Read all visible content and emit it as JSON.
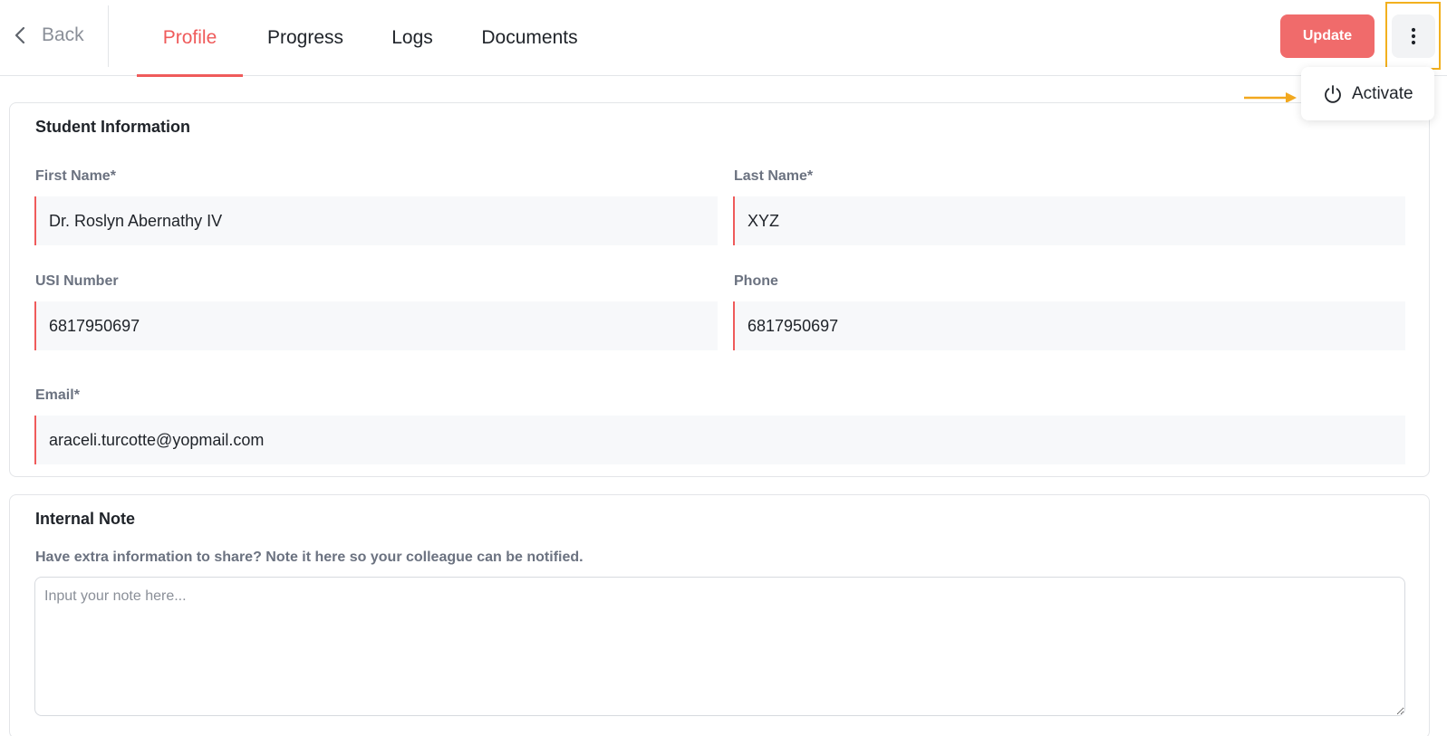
{
  "header": {
    "back_label": "Back",
    "tabs": [
      {
        "label": "Profile",
        "active": true
      },
      {
        "label": "Progress",
        "active": false
      },
      {
        "label": "Logs",
        "active": false
      },
      {
        "label": "Documents",
        "active": false
      }
    ],
    "update_label": "Update",
    "more_icon": "more-vertical-icon"
  },
  "menu": {
    "items": [
      {
        "label": "Activate",
        "icon": "power-icon"
      }
    ]
  },
  "student_info": {
    "title": "Student Information",
    "first_name": {
      "label": "First Name*",
      "value": "Dr. Roslyn Abernathy IV"
    },
    "last_name": {
      "label": "Last Name*",
      "value": "XYZ"
    },
    "usi": {
      "label": "USI Number",
      "value": "6817950697"
    },
    "phone": {
      "label": "Phone",
      "value": "6817950697"
    },
    "email": {
      "label": "Email*",
      "value": "araceli.turcotte@yopmail.com"
    }
  },
  "internal_note": {
    "title": "Internal Note",
    "description": "Have extra information to share? Note it here so your colleague can be notified.",
    "placeholder": "Input your note here...",
    "value": ""
  },
  "colors": {
    "accent": "#ef5b5b",
    "button": "#f06b6b",
    "highlight": "#f2b01e"
  }
}
